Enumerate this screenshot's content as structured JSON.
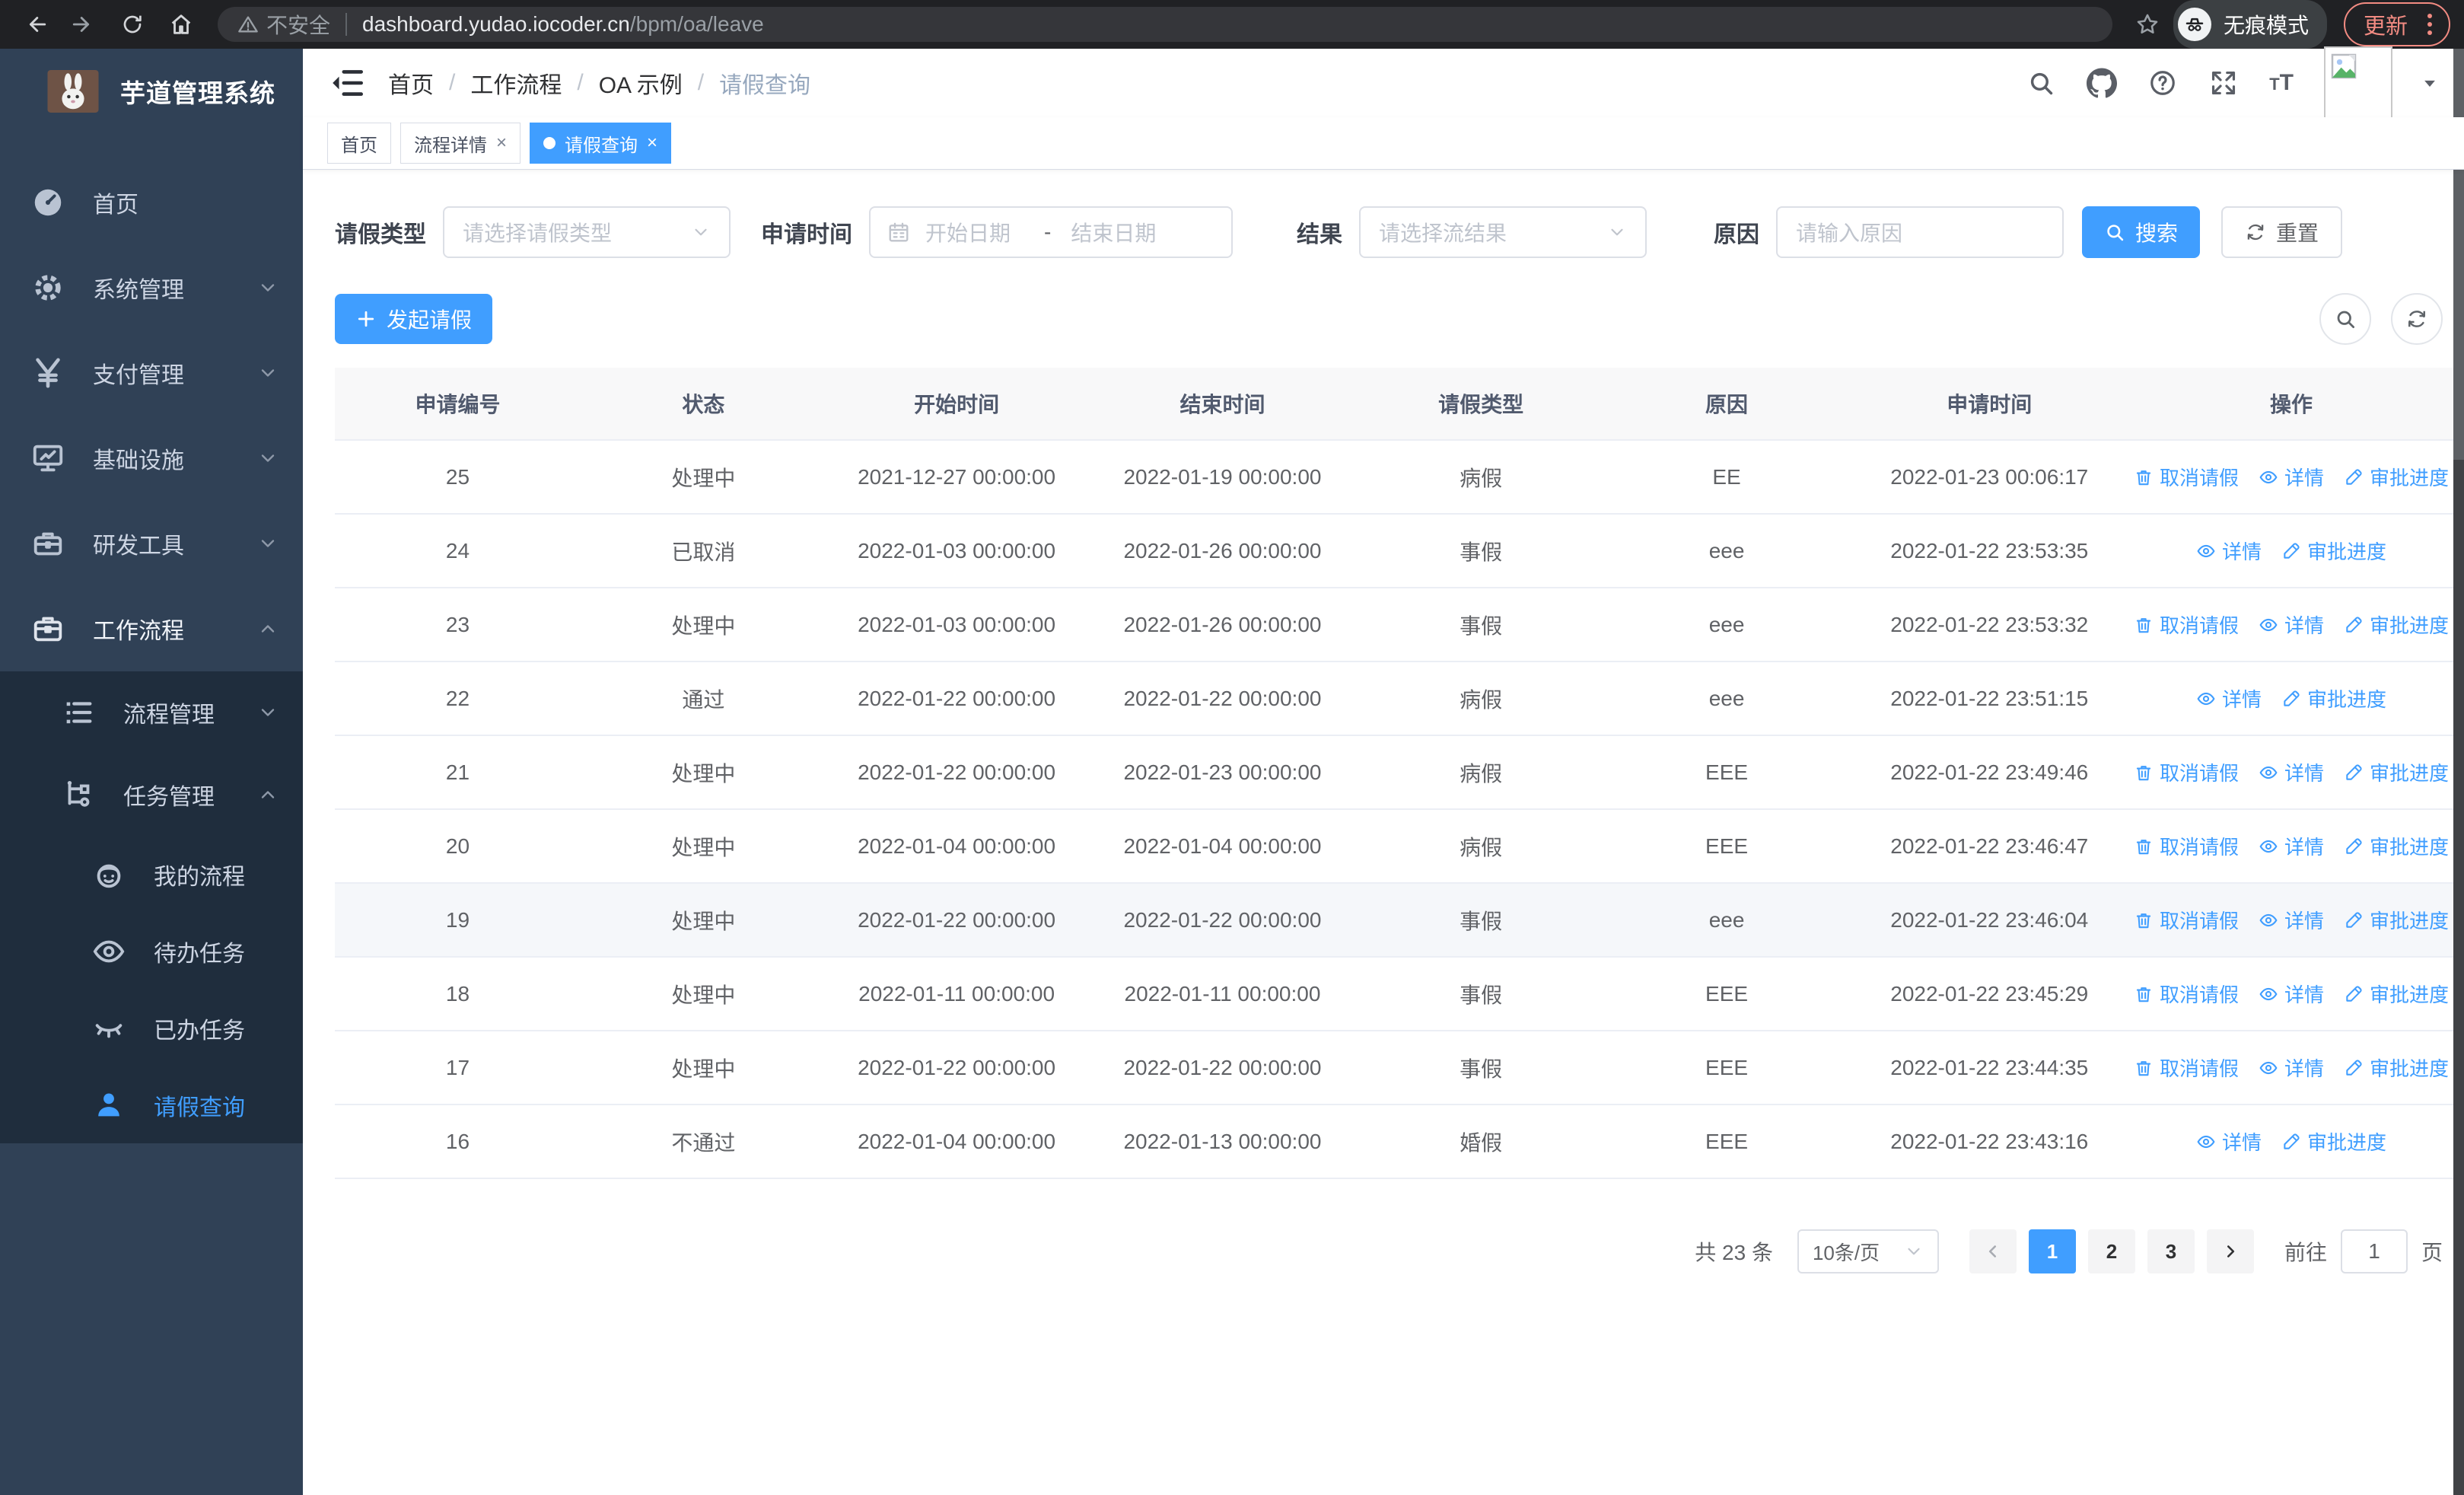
{
  "browser": {
    "not_secure": "不安全",
    "url_host": "dashboard.yudao.iocoder.cn",
    "url_path": "/bpm/oa/leave",
    "incognito_label": "无痕模式",
    "update_label": "更新"
  },
  "colors": {
    "accent": "#409EFF",
    "sidebar_bg": "#304156",
    "submenu_bg": "#1f2d3d",
    "update_badge": "#f28b82",
    "table_header_bg": "#f8f8f9",
    "row_hover_bg": "#f5f7fa",
    "action_link": "#409EFF"
  },
  "sidebar": {
    "title": "芋道管理系统",
    "items": [
      {
        "icon": "gauge",
        "label": "首页",
        "level": 0,
        "chevron": "",
        "state": "normal"
      },
      {
        "icon": "gear",
        "label": "系统管理",
        "level": 0,
        "chevron": "down",
        "state": "normal"
      },
      {
        "icon": "yen",
        "label": "支付管理",
        "level": 0,
        "chevron": "down",
        "state": "normal"
      },
      {
        "icon": "monitor",
        "label": "基础设施",
        "level": 0,
        "chevron": "down",
        "state": "normal"
      },
      {
        "icon": "toolbox",
        "label": "研发工具",
        "level": 0,
        "chevron": "down",
        "state": "normal"
      },
      {
        "icon": "briefcase",
        "label": "工作流程",
        "level": 0,
        "chevron": "up",
        "state": "white"
      },
      {
        "icon": "list",
        "label": "流程管理",
        "level": 1,
        "chevron": "down",
        "state": "normal"
      },
      {
        "icon": "flow",
        "label": "任务管理",
        "level": 1,
        "chevron": "up",
        "state": "normal"
      },
      {
        "icon": "face",
        "label": "我的流程",
        "level": 2,
        "chevron": "",
        "state": "normal"
      },
      {
        "icon": "eye",
        "label": "待办任务",
        "level": 2,
        "chevron": "",
        "state": "normal"
      },
      {
        "icon": "eyeclosed",
        "label": "已办任务",
        "level": 2,
        "chevron": "",
        "state": "normal"
      },
      {
        "icon": "person",
        "label": "请假查询",
        "level": 2,
        "chevron": "",
        "state": "blue"
      }
    ]
  },
  "header": {
    "breadcrumb": [
      "首页",
      "工作流程",
      "OA 示例",
      "请假查询"
    ]
  },
  "tabs": [
    {
      "label": "首页",
      "closable": false,
      "active": false
    },
    {
      "label": "流程详情",
      "closable": true,
      "active": false
    },
    {
      "label": "请假查询",
      "closable": true,
      "active": true
    }
  ],
  "filters": {
    "type_label": "请假类型",
    "type_placeholder": "请选择请假类型",
    "time_label": "申请时间",
    "start_placeholder": "开始日期",
    "range_separator": "-",
    "end_placeholder": "结束日期",
    "result_label": "结果",
    "result_placeholder": "请选择流结果",
    "reason_label": "原因",
    "reason_placeholder": "请输入原因",
    "search_label": "搜索",
    "reset_label": "重置"
  },
  "toolbar": {
    "create_label": "发起请假"
  },
  "table": {
    "columns": [
      "申请编号",
      "状态",
      "开始时间",
      "结束时间",
      "请假类型",
      "原因",
      "申请时间",
      "操作"
    ],
    "action_labels": {
      "cancel": "取消请假",
      "detail": "详情",
      "progress": "审批进度"
    },
    "rows": [
      {
        "no": "25",
        "status": "处理中",
        "start": "2021-12-27 00:00:00",
        "end": "2022-01-19 00:00:00",
        "type": "病假",
        "reason": "EE",
        "apply": "2022-01-23 00:06:17",
        "actions": [
          "cancel",
          "detail",
          "progress"
        ],
        "hover": false
      },
      {
        "no": "24",
        "status": "已取消",
        "start": "2022-01-03 00:00:00",
        "end": "2022-01-26 00:00:00",
        "type": "事假",
        "reason": "eee",
        "apply": "2022-01-22 23:53:35",
        "actions": [
          "detail",
          "progress"
        ],
        "hover": false
      },
      {
        "no": "23",
        "status": "处理中",
        "start": "2022-01-03 00:00:00",
        "end": "2022-01-26 00:00:00",
        "type": "事假",
        "reason": "eee",
        "apply": "2022-01-22 23:53:32",
        "actions": [
          "cancel",
          "detail",
          "progress"
        ],
        "hover": false
      },
      {
        "no": "22",
        "status": "通过",
        "start": "2022-01-22 00:00:00",
        "end": "2022-01-22 00:00:00",
        "type": "病假",
        "reason": "eee",
        "apply": "2022-01-22 23:51:15",
        "actions": [
          "detail",
          "progress"
        ],
        "hover": false
      },
      {
        "no": "21",
        "status": "处理中",
        "start": "2022-01-22 00:00:00",
        "end": "2022-01-23 00:00:00",
        "type": "病假",
        "reason": "EEE",
        "apply": "2022-01-22 23:49:46",
        "actions": [
          "cancel",
          "detail",
          "progress"
        ],
        "hover": false
      },
      {
        "no": "20",
        "status": "处理中",
        "start": "2022-01-04 00:00:00",
        "end": "2022-01-04 00:00:00",
        "type": "病假",
        "reason": "EEE",
        "apply": "2022-01-22 23:46:47",
        "actions": [
          "cancel",
          "detail",
          "progress"
        ],
        "hover": false
      },
      {
        "no": "19",
        "status": "处理中",
        "start": "2022-01-22 00:00:00",
        "end": "2022-01-22 00:00:00",
        "type": "事假",
        "reason": "eee",
        "apply": "2022-01-22 23:46:04",
        "actions": [
          "cancel",
          "detail",
          "progress"
        ],
        "hover": true
      },
      {
        "no": "18",
        "status": "处理中",
        "start": "2022-01-11 00:00:00",
        "end": "2022-01-11 00:00:00",
        "type": "事假",
        "reason": "EEE",
        "apply": "2022-01-22 23:45:29",
        "actions": [
          "cancel",
          "detail",
          "progress"
        ],
        "hover": false
      },
      {
        "no": "17",
        "status": "处理中",
        "start": "2022-01-22 00:00:00",
        "end": "2022-01-22 00:00:00",
        "type": "事假",
        "reason": "EEE",
        "apply": "2022-01-22 23:44:35",
        "actions": [
          "cancel",
          "detail",
          "progress"
        ],
        "hover": false
      },
      {
        "no": "16",
        "status": "不通过",
        "start": "2022-01-04 00:00:00",
        "end": "2022-01-13 00:00:00",
        "type": "婚假",
        "reason": "EEE",
        "apply": "2022-01-22 23:43:16",
        "actions": [
          "detail",
          "progress"
        ],
        "hover": false
      }
    ]
  },
  "pagination": {
    "total": "共 23 条",
    "page_size": "10条/页",
    "pages": [
      "1",
      "2",
      "3"
    ],
    "active_page": "1",
    "goto_label": "前往",
    "goto_value": "1",
    "goto_unit": "页"
  }
}
